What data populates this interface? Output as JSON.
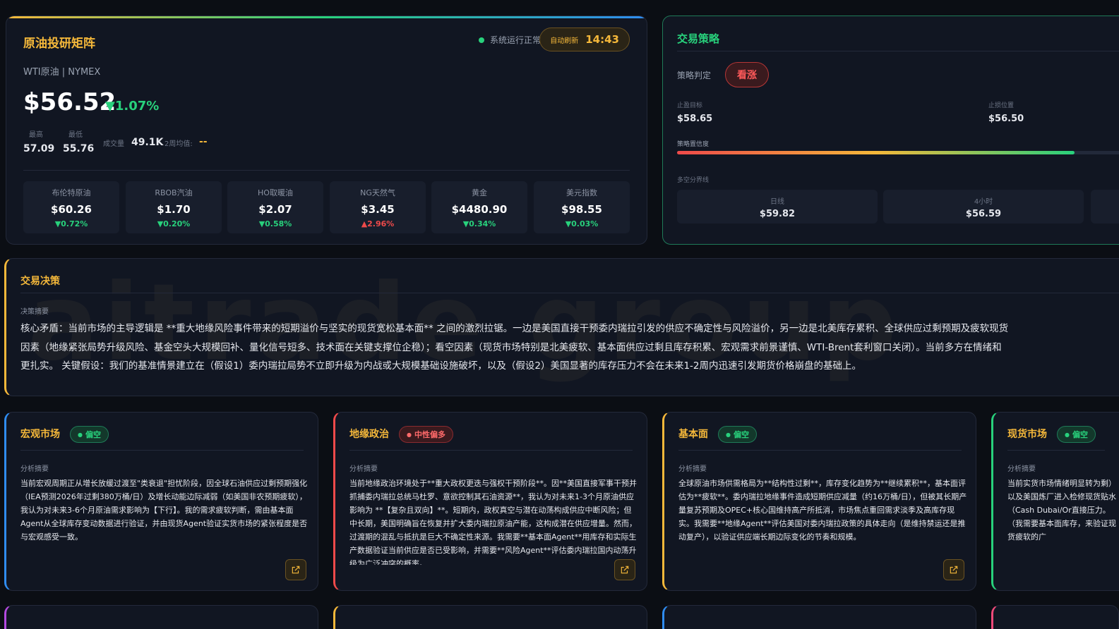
{
  "market": {
    "title": "原油投研矩阵",
    "status": "系统运行正常",
    "refresh_label": "自动刷新",
    "refresh_time": "14:43",
    "subtitle": "WTI原油 | NYMEX",
    "price": "$56.52",
    "change": "▼1.07%",
    "high_label": "最高",
    "high": "57.09",
    "low_label": "最低",
    "low": "55.76",
    "volume_label": "成交量",
    "volume": "49.1K",
    "avg_label": "2周均值:",
    "avg": "--",
    "tiles": [
      {
        "name": "布伦特原油",
        "value": "$60.26",
        "change": "▼0.72%"
      },
      {
        "name": "RBOB汽油",
        "value": "$1.70",
        "change": "▼0.20%"
      },
      {
        "name": "HO取暖油",
        "value": "$2.07",
        "change": "▼0.58%"
      },
      {
        "name": "NG天然气",
        "value": "$3.45",
        "change": "▲2.96%"
      },
      {
        "name": "黄金",
        "value": "$4480.90",
        "change": "▼0.34%"
      },
      {
        "name": "美元指数",
        "value": "$98.55",
        "change": "▼0.03%"
      }
    ]
  },
  "strategy": {
    "title": "交易策略",
    "judgement_label": "策略判定",
    "judgement": "看涨",
    "take_profit_label": "止盈目标",
    "take_profit": "$58.65",
    "stop_loss_label": "止损位置",
    "stop_loss": "$56.50",
    "confidence_label": "策略置信度",
    "confidence": 0.88,
    "divide_label": "多空分界线",
    "levels": [
      {
        "name": "日线",
        "value": "$59.82"
      },
      {
        "name": "4小时",
        "value": "$56.59"
      }
    ]
  },
  "decision": {
    "title": "交易决策",
    "watermark": "aitrade group",
    "summary_label": "决策摘要",
    "line1": "核心矛盾：当前市场的主导逻辑是 **重大地缘风险事件带来的短期溢价与坚实的现货宽松基本面** 之间的激烈拉锯。一边是美国直接干预委内瑞拉引发的供应不确定性与风险溢价，另一边是北美库存累积、全球供应过剩预期及疲软现货",
    "line2": "因素（地缘紧张局势升级风险、基金空头大规模回补、量化信号短多、技术面在关键支撑位企稳）；看空因素（现货市场特别是北美疲软、基本面供应过剩且库存积累、宏观需求前景谨慎、WTI-Brent套利窗口关闭）。当前多方在情绪和",
    "line3": "更扎实。 关键假设：我们的基准情景建立在（假设1）委内瑞拉局势不立即升级为内战或大规模基础设施破坏，以及（假设2）美国显著的库存压力不会在未来1-2周内迅速引发期货价格崩盘的基础上。"
  },
  "cards": [
    {
      "title": "宏观市场",
      "badge": "偏空",
      "summary_label": "分析摘要",
      "body": "当前宏观周期正从增长放缓过渡至\"类衰退\"担忧阶段，因全球石油供应过剩预期强化（IEA预测2026年过剩380万桶/日）及增长动能边际减弱（如美国非农预期疲软），我认为对未来3-6个月原油需求影响为【下行】。我的需求疲软判断，需由基本面Agent从全球库存变动数据进行验证，并由现货Agent验证实货市场的紧张程度是否与宏观感受一致。"
    },
    {
      "title": "地缘政治",
      "badge": "中性偏多",
      "summary_label": "分析摘要",
      "body": "当前地缘政治环境处于**重大政权更迭与强权干预阶段**。因**美国直接军事干预并抓捕委内瑞拉总统马杜罗、意欲控制其石油资源**，我认为对未来1-3个月原油供应影响为 **【复杂且双向】**。短期内，政权真空与潜在动荡构成供应中断风险；但中长期，美国明确旨在恢复并扩大委内瑞拉原油产能，这构成潜在供应增量。然而，过渡期的混乱与抵抗是巨大不确定性来源。我需要**基本面Agent**用库存和实际生产数据验证当前供应是否已受影响，并需要**风险Agent**评估委内瑞拉国内动荡升级为广泛冲突的概率。"
    },
    {
      "title": "基本面",
      "badge": "偏空",
      "summary_label": "分析摘要",
      "body": "全球原油市场供需格局为**结构性过剩**，库存变化趋势为**继续累积**，基本面评估为**疲软**。委内瑞拉地缘事件造成短期供应减量（约16万桶/日），但被其长期产量复苏预期及OPEC+核心国维持高产所抵消，市场焦点重回需求淡季及高库存现实。我需要**地缘Agent**评估美国对委内瑞拉政策的具体走向（是维持禁运还是推动复产），以验证供应端长期边际变化的节奏和规模。"
    },
    {
      "title": "现货市场",
      "badge": "偏空",
      "summary_label": "分析摘要",
      "body": "当前实货市场情绪明显转为剩）以及美国炼厂进入检修现货贴水（Cash Dubai/Or直接压力。（我需要基本面库存，来验证现货疲软的广"
    }
  ]
}
